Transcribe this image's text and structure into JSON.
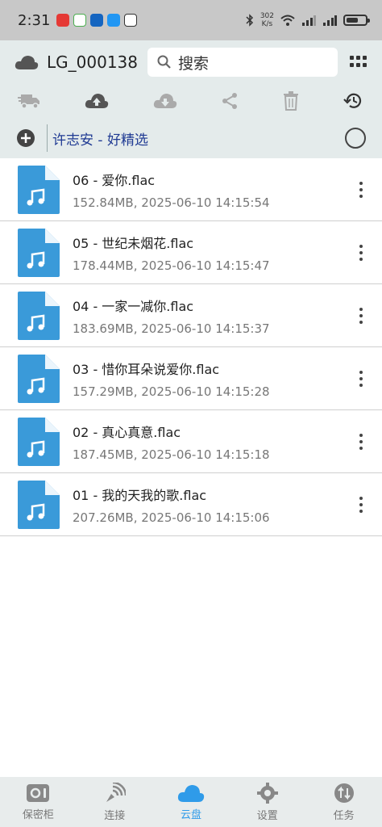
{
  "status_bar": {
    "time": "2:31",
    "speed_value": "302",
    "speed_unit": "K/s"
  },
  "header": {
    "title": "LG_000138",
    "search_placeholder": "搜索"
  },
  "folder": {
    "path": "许志安 - 好精选"
  },
  "files": [
    {
      "name": "06 - 爱你.flac",
      "meta": "152.84MB, 2025-06-10 14:15:54"
    },
    {
      "name": "05 - 世纪未烟花.flac",
      "meta": "178.44MB, 2025-06-10 14:15:47"
    },
    {
      "name": "04 - 一家一减你.flac",
      "meta": "183.69MB, 2025-06-10 14:15:37"
    },
    {
      "name": "03 - 惜你耳朵说爱你.flac",
      "meta": "157.29MB, 2025-06-10 14:15:28"
    },
    {
      "name": "02 - 真心真意.flac",
      "meta": "187.45MB, 2025-06-10 14:15:18"
    },
    {
      "name": "01 - 我的天我的歌.flac",
      "meta": "207.26MB, 2025-06-10 14:15:06"
    }
  ],
  "nav": [
    {
      "label": "保密柜",
      "icon": "safe-icon"
    },
    {
      "label": "连接",
      "icon": "connect-icon"
    },
    {
      "label": "云盘",
      "icon": "cloud-icon"
    },
    {
      "label": "设置",
      "icon": "gear-icon"
    },
    {
      "label": "任务",
      "icon": "transfer-icon"
    }
  ],
  "colors": {
    "accent": "#2f9be9",
    "file_icon": "#3a9ad9",
    "header_bg": "#e4ebeb",
    "folder_text": "#1f3a93"
  }
}
